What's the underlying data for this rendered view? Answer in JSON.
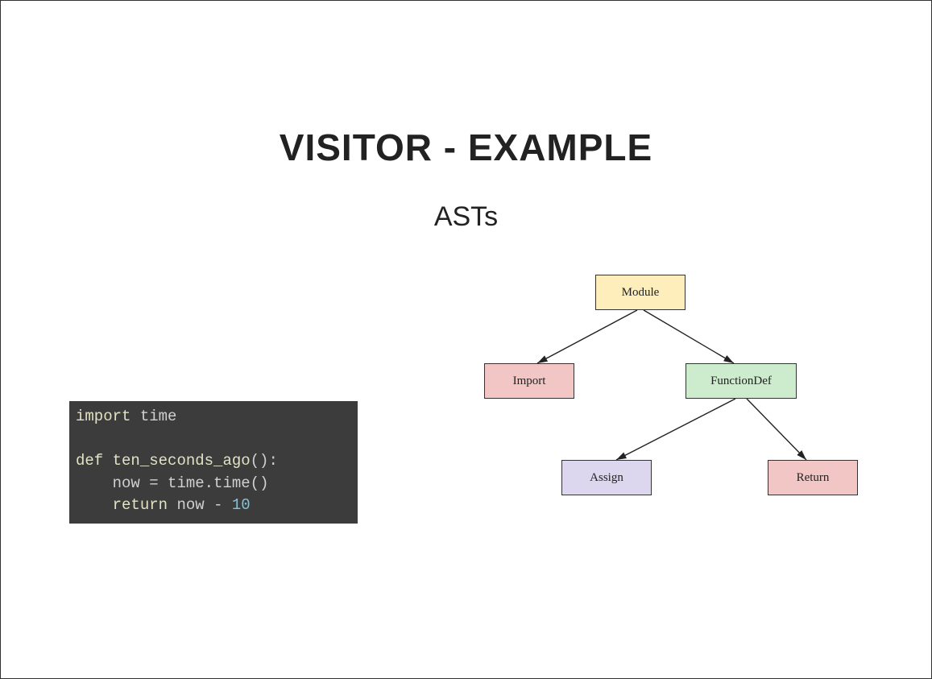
{
  "title": "VISITOR - EXAMPLE",
  "subtitle": "ASTs",
  "code": {
    "line1": {
      "kw": "import",
      "mod": "time"
    },
    "line2": {
      "kw": "def",
      "fn": "ten_seconds_ago",
      "paren": "():"
    },
    "line3": {
      "indent": "    ",
      "lhs": "now",
      "eq": "=",
      "call": "time.time()"
    },
    "line4": {
      "indent": "    ",
      "kw": "return",
      "var": "now",
      "op": "-",
      "num": "10"
    }
  },
  "diagram": {
    "module": "Module",
    "import": "Import",
    "funcdef": "FunctionDef",
    "assign": "Assign",
    "return": "Return"
  }
}
